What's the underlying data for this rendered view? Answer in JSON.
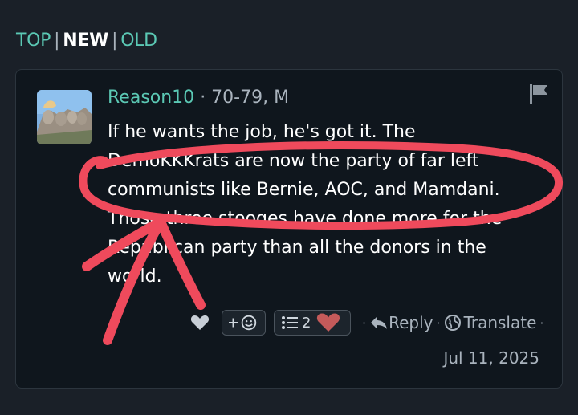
{
  "sort": {
    "top": "TOP",
    "new": "NEW",
    "old": "OLD",
    "separator": "|",
    "active": "NEW"
  },
  "comment": {
    "username": "Reason10",
    "meta": "· 70-79, M",
    "text": "If he wants the job, he's got it. The DemoKKKrats are now the party of far left communists like Bernie, AOC, and Mamdani. Those three stooges have done more for the Republican party than all the donors in the world.",
    "reaction_count": "2",
    "reply_label": "Reply",
    "translate_label": "Translate",
    "date": "Jul 11, 2025"
  },
  "colors": {
    "accent": "#5bc8b4",
    "background": "#1a2028",
    "card": "#0f161d",
    "annotation": "#ef4a5c"
  },
  "icons": {
    "flag": "flag-icon",
    "like": "heart-icon",
    "add_reaction": "smiley-icon",
    "reactions_list": "list-icon",
    "reply": "reply-arrow-icon",
    "translate": "globe-icon"
  }
}
